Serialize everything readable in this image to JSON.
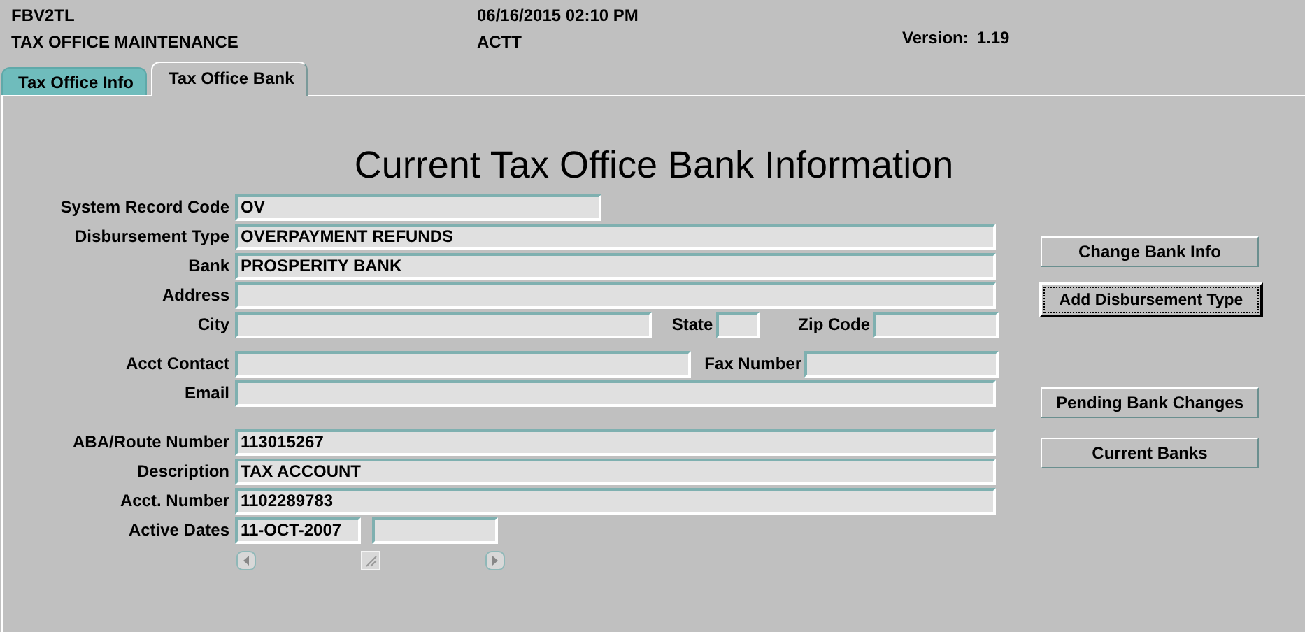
{
  "header": {
    "form_code": "FBV2TL",
    "form_name": "TAX OFFICE MAINTENANCE",
    "datetime": "06/16/2015 02:10 PM",
    "user": "ACTT",
    "version_label": "Version:",
    "version": "1.19"
  },
  "tabs": [
    {
      "label": "Tax Office Info",
      "selected": false
    },
    {
      "label": "Tax Office Bank",
      "selected": true
    }
  ],
  "title": "Current Tax Office Bank Information",
  "rows": [
    {
      "label": "System Record Code",
      "fields": [
        {
          "kind": "short",
          "value": "OV"
        }
      ]
    },
    {
      "label": "Disbursement Type",
      "fields": [
        {
          "kind": "full",
          "value": "OVERPAYMENT REFUNDS"
        }
      ]
    },
    {
      "label": "Bank",
      "fields": [
        {
          "kind": "full",
          "value": "PROSPERITY BANK"
        }
      ]
    },
    {
      "label": "Address",
      "fields": [
        {
          "kind": "full"
        }
      ]
    },
    {
      "label": "City",
      "fields": [
        {
          "kind": "city"
        },
        {
          "kind": "state",
          "label": "State"
        },
        {
          "kind": "zip",
          "label": "Zip Code"
        }
      ]
    },
    {
      "label": "Acct Contact",
      "fields": [
        {
          "kind": "contact"
        },
        {
          "kind": "fax",
          "label": "Fax Number"
        }
      ]
    },
    {
      "label": "Email",
      "fields": [
        {
          "kind": "full"
        }
      ]
    },
    {
      "label": "ABA/Route Number",
      "fields": [
        {
          "kind": "full",
          "value": "113015267"
        }
      ]
    },
    {
      "label": "Description",
      "fields": [
        {
          "kind": "full",
          "value": "TAX ACCOUNT"
        }
      ]
    },
    {
      "label": "Acct. Number",
      "fields": [
        {
          "kind": "full",
          "value": "1102289783"
        }
      ]
    },
    {
      "label": "Active Dates",
      "fields": [
        {
          "kind": "date",
          "value": "11-OCT-2007"
        },
        {
          "kind": "date"
        }
      ]
    }
  ],
  "buttons": [
    {
      "label": "Change Bank Info",
      "focused": false
    },
    {
      "label": "Add Disbursement Type",
      "focused": true
    },
    {
      "label": "Pending Bank Changes",
      "focused": false
    },
    {
      "label": "Current Banks",
      "focused": false
    }
  ]
}
